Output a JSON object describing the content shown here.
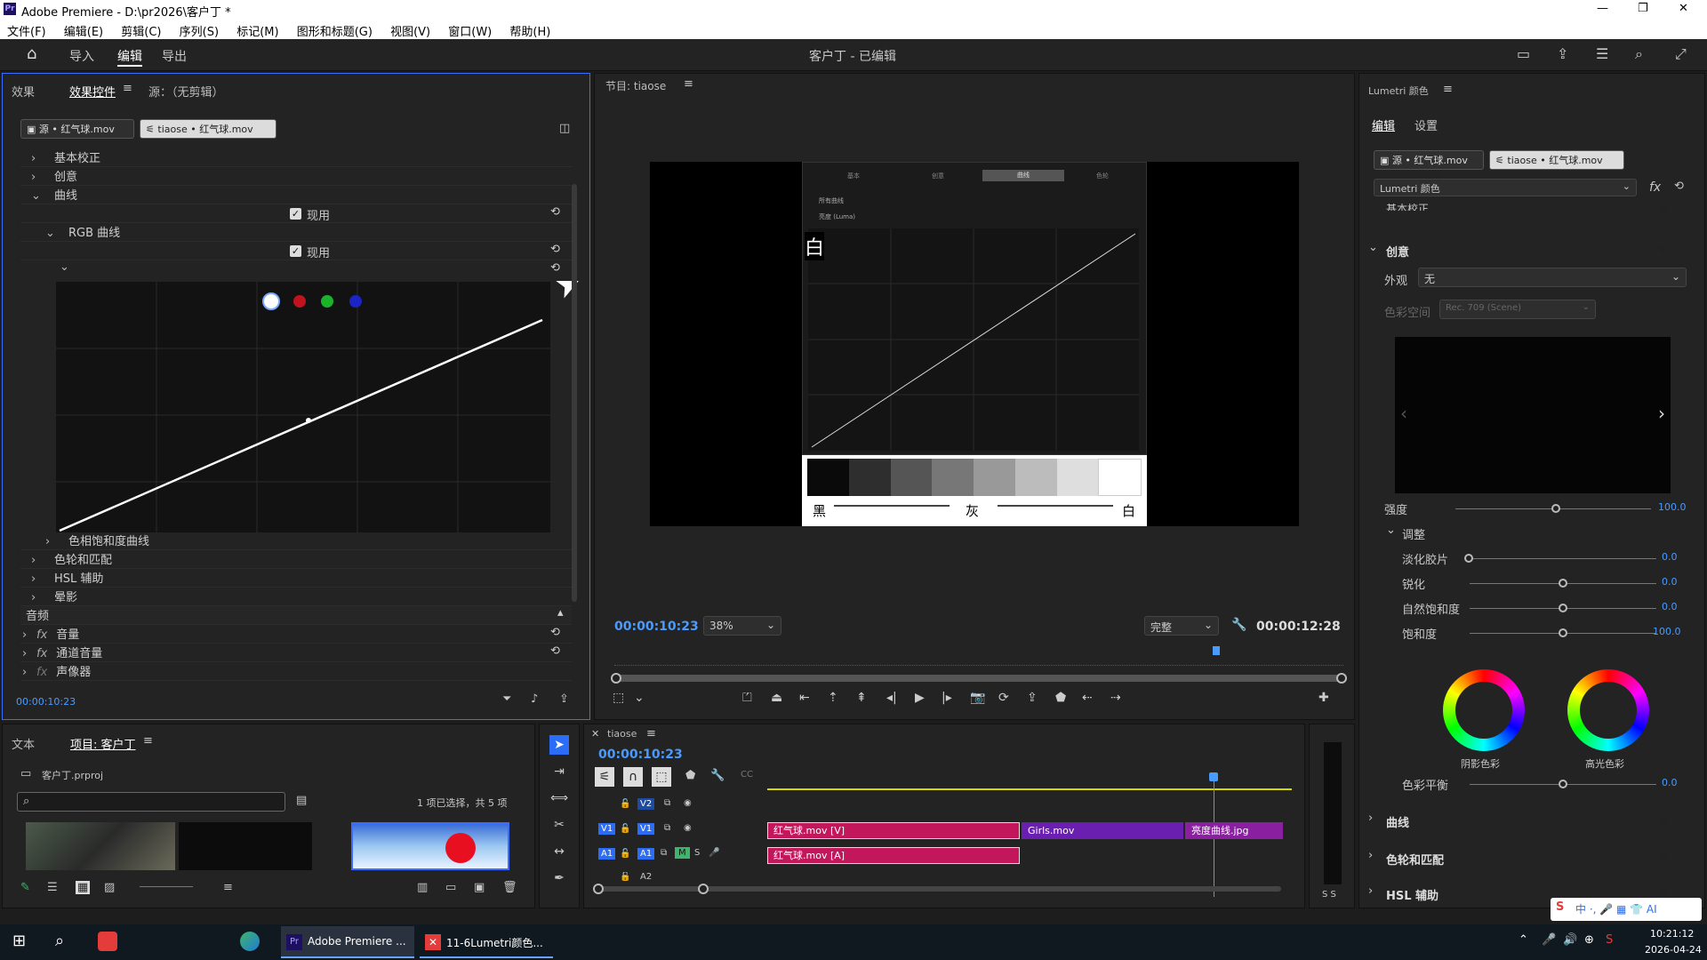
{
  "window": {
    "title": "Adobe Premiere - D:\\pr2026\\客户丁 *",
    "controls": [
      "—",
      "❐",
      "✕"
    ]
  },
  "menu": [
    "文件(F)",
    "编辑(E)",
    "剪辑(C)",
    "序列(S)",
    "标记(M)",
    "图形和标题(G)",
    "视图(V)",
    "窗口(W)",
    "帮助(H)"
  ],
  "header": {
    "tabs": [
      "导入",
      "编辑",
      "导出"
    ],
    "project_title": "客户丁 - 已编辑"
  },
  "effect_controls": {
    "tabs": [
      "效果",
      "效果控件",
      "源：（无剪辑）"
    ],
    "clip_tabs": [
      "源 • 红气球.mov",
      "tiaose • 红气球.mov"
    ],
    "rows": {
      "basic": "基本校正",
      "creative": "创意",
      "curves": "曲线",
      "enable": "现用",
      "rgb_curves": "RGB 曲线",
      "enable2": "现用",
      "hue_sat": "色相饱和度曲线",
      "wheels": "色轮和匹配",
      "hsl": "HSL 辅助",
      "vignette": "晕影"
    },
    "audio_section": "音频",
    "audio_rows": [
      "音量",
      "通道音量",
      "声像器"
    ],
    "timecode": "00:00:10:23"
  },
  "program_monitor": {
    "title": "节目: tiaose",
    "timecode_left": "00:00:10:23",
    "zoom": "38%",
    "quality": "完整",
    "timecode_right": "00:00:12:28",
    "frame": {
      "tabs": [
        "基本",
        "创意",
        "曲线",
        "色轮"
      ],
      "luma_label": "亮度 (Luma)",
      "all_label": "所有曲线",
      "white_char": "白",
      "bar_labels": [
        "黑",
        "灰",
        "白"
      ]
    }
  },
  "lumetri": {
    "title": "Lumetri 颜色",
    "tabs": [
      "编辑",
      "设置"
    ],
    "clip_tabs": [
      "源 • 红气球.mov",
      "tiaose • 红气球.mov"
    ],
    "effect_select": "Lumetri 颜色",
    "section_basic": "基本校正",
    "creative": "创意",
    "look_label": "外观",
    "look_value": "无",
    "colorspace_label": "色彩空间",
    "colorspace_value": "Rec. 709 (Scene)",
    "intensity_label": "强度",
    "intensity_value": "100.0",
    "adjust": "调整",
    "sliders": [
      {
        "label": "淡化胶片",
        "value": "0.0"
      },
      {
        "label": "锐化",
        "value": "0.0"
      },
      {
        "label": "自然饱和度",
        "value": "0.0"
      },
      {
        "label": "饱和度",
        "value": "100.0"
      }
    ],
    "wheel_labels": [
      "阴影色彩",
      "高光色彩"
    ],
    "balance_label": "色彩平衡",
    "balance_value": "0.0",
    "sections": [
      "曲线",
      "色轮和匹配",
      "HSL 辅助"
    ]
  },
  "project": {
    "tabs": [
      "文本",
      "项目: 客户丁"
    ],
    "file": "客户丁.prproj",
    "search_placeholder": "",
    "selection": "1 项已选择，共 5 项"
  },
  "timeline": {
    "title": "tiaose",
    "timecode": "00:00:10:23",
    "tracks": [
      "V2",
      "V1",
      "A1",
      "A2"
    ],
    "clips": {
      "v1_a": "红气球.mov [V]",
      "v1_b": "Girls.mov",
      "v1_c": "亮度曲线.jpg",
      "a1_a": "红气球.mov [A]"
    },
    "meter_label": "S S"
  },
  "taskbar": {
    "apps": [
      "Adobe Premiere ...",
      "11-6Lumetri颜色..."
    ],
    "time": "10:21:12",
    "date": "2026-04-24"
  },
  "colors": {
    "accent": "#4a9bff",
    "clip_pink": "#c2185b",
    "clip_purple": "#6a1fb0",
    "audio_green": "#3fb56b"
  }
}
